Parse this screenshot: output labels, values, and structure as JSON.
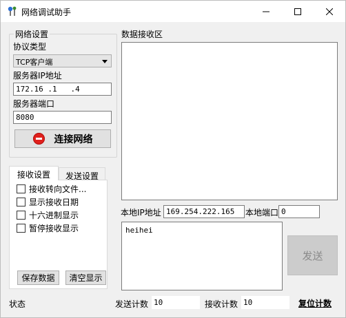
{
  "window": {
    "title": "网络调试助手"
  },
  "network_settings": {
    "group_title": "网络设置",
    "protocol_label": "协议类型",
    "protocol_value": "TCP客户端",
    "server_ip_label": "服务器IP地址",
    "server_ip_value": "172.16 .1   .4",
    "server_port_label": "服务器端口",
    "server_port_value": "8080",
    "connect_button": "连接网络"
  },
  "receive_panel": {
    "tabs": [
      {
        "label": "接收设置",
        "active": true
      },
      {
        "label": "发送设置",
        "active": false
      }
    ],
    "options": [
      {
        "label": "接收转向文件...",
        "checked": false
      },
      {
        "label": "显示接收日期",
        "checked": false
      },
      {
        "label": "十六进制显示",
        "checked": false
      },
      {
        "label": "暂停接收显示",
        "checked": false
      }
    ],
    "save_button": "保存数据",
    "clear_button": "清空显示"
  },
  "receive_area": {
    "label": "数据接收区",
    "content": ""
  },
  "local": {
    "ip_label": "本地IP地址",
    "ip_value": "169.254.222.165",
    "port_label": "本地端口",
    "port_value": "0"
  },
  "send": {
    "text": "heihei",
    "button": "发送"
  },
  "status_bar": {
    "status_label": "状态",
    "send_count_label": "发送计数",
    "send_count_value": "10",
    "receive_count_label": "接收计数",
    "receive_count_value": "10",
    "reset_label": "复位计数"
  },
  "colors": {
    "stop_icon": "#e0201c",
    "window_bg": "#f0f0f0"
  }
}
